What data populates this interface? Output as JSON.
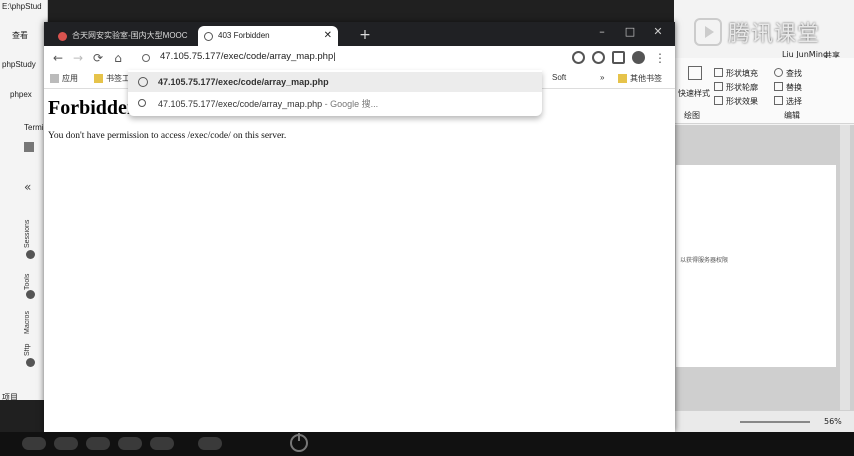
{
  "left_window": {
    "path_fragment": "E:\\phpStud",
    "menu_item": "查看",
    "app_title": "phpStudy",
    "tab_label": "phpex",
    "terminal_label": "Termi",
    "side_tabs": [
      "Sessions",
      "Tools",
      "Macros",
      "Sftp"
    ],
    "bottom_text": "项目"
  },
  "chrome": {
    "tabs": [
      {
        "title": "合天网安实验室-国内大型MOOC",
        "favicon": "hetian-icon",
        "active": false
      },
      {
        "title": "403 Forbidden",
        "favicon": "globe-icon",
        "active": true
      }
    ],
    "new_tab_label": "+",
    "window_controls": [
      "–",
      "□",
      "✕"
    ],
    "address": "47.105.75.177/exec/code/array_map.php|",
    "bookmarks": [
      "应用",
      "书签工",
      "Soft",
      "»",
      "其他书签"
    ],
    "suggestions": [
      {
        "text": "47.105.75.177/exec/code/array_map.php",
        "hint": "",
        "icon": "globe-icon",
        "selected": true
      },
      {
        "text": "47.105.75.177/exec/code/array_map.php",
        "hint": " - Google 搜...",
        "icon": "search-icon",
        "selected": false
      }
    ],
    "page": {
      "heading": "Forbidden",
      "message": "You don't have permission to access /exec/code/ on this server."
    }
  },
  "word": {
    "watermark": "腾讯课堂",
    "user": "Liu JunMing",
    "share": "共享",
    "ribbon": {
      "styles_label": "快速样式",
      "shape_fill": "形状填充",
      "shape_outline": "形状轮廓",
      "shape_effect": "形状效果",
      "find": "查找",
      "replace": "替换",
      "select": "选择",
      "group_label": "绘图",
      "edit_label": "编辑"
    },
    "doc_text": "以获得服务器权限",
    "zoom": "56%"
  },
  "taskbar": {
    "items": [
      "",
      "",
      "",
      "",
      "",
      ""
    ]
  },
  "colors": {
    "tabstrip": "#202124",
    "page_bg": "#ffffff",
    "dropdown_selected": "#ececec"
  }
}
